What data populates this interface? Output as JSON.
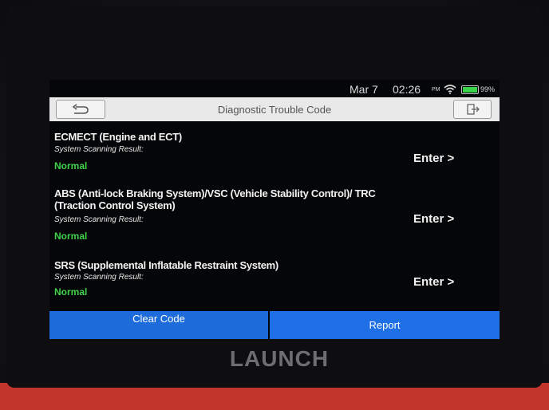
{
  "status": {
    "date": "Mar 7",
    "time": "02:26",
    "ampm": "PM",
    "battery": "99%",
    "battery_level": 0.99
  },
  "header": {
    "title": "Diagnostic Trouble Code",
    "back_icon": "back-arrow-icon",
    "exit_icon": "exit-icon"
  },
  "systems": [
    {
      "name": "ECMECT (Engine and ECT)",
      "subtitle": "System Scanning Result:",
      "status": "Normal",
      "enter": "Enter >"
    },
    {
      "name": "ABS (Anti-lock Braking System)/VSC (Vehicle Stability Control)/ TRC (Traction Control System)",
      "subtitle": "System Scanning Result:",
      "status": "Normal",
      "enter": "Enter >"
    },
    {
      "name": "SRS (Supplemental Inflatable Restraint System)",
      "subtitle": "System Scanning Result:",
      "status": "Normal",
      "enter": "Enter >"
    }
  ],
  "footer": {
    "clear_label": "Clear Code",
    "report_label": "Report"
  },
  "device": {
    "brand": "LAUNCH"
  },
  "colors": {
    "normal_status": "#40d24a",
    "button_blue": "#1f6fe6",
    "device_edge": "#c0342b"
  }
}
